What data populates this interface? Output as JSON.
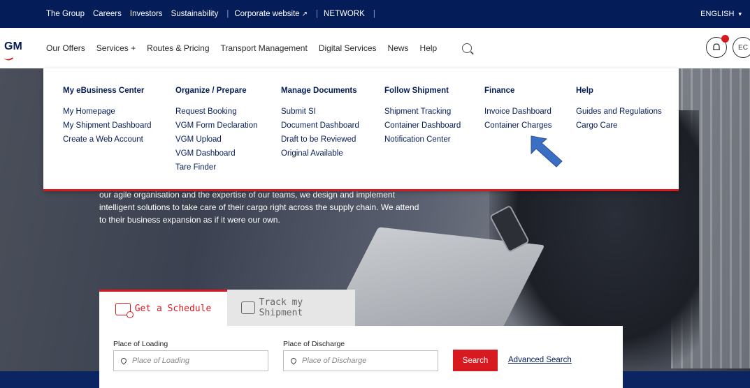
{
  "topbar": {
    "links": [
      "The Group",
      "Careers",
      "Investors",
      "Sustainability"
    ],
    "corporate_website": "Corporate website",
    "network": "NETWORK",
    "language": "ENGLISH"
  },
  "nav": {
    "logo": "GM",
    "items": [
      "Our Offers",
      "Services +",
      "Routes & Pricing",
      "Transport Management",
      "Digital Services",
      "News",
      "Help"
    ],
    "active": "Transport Management",
    "account_initials": "EC"
  },
  "dropdown": {
    "columns": [
      {
        "title": "My eBusiness Center",
        "items": [
          "My Homepage",
          "My Shipment Dashboard",
          "Create a Web Account"
        ]
      },
      {
        "title": "Organize / Prepare",
        "items": [
          "Request Booking",
          "VGM Form Declaration",
          "VGM Upload",
          "VGM Dashboard",
          "Tare Finder"
        ]
      },
      {
        "title": "Manage Documents",
        "items": [
          "Submit SI",
          "Document Dashboard",
          "Draft to be Reviewed",
          "Original Available"
        ]
      },
      {
        "title": "Follow Shipment",
        "items": [
          "Shipment Tracking",
          "Container Dashboard",
          "Notification Center"
        ]
      },
      {
        "title": "Finance",
        "items": [
          "Invoice Dashboard",
          "Container Charges"
        ]
      },
      {
        "title": "Help",
        "items": [
          "Guides and Regulations",
          "Cargo Care"
        ]
      }
    ]
  },
  "hero": {
    "text": "our agile organisation and the expertise of our teams, we design and implement intelligent solutions to take care of their cargo right across the supply chain. We attend to their business expansion as if it were our own."
  },
  "search": {
    "tab_schedule": "Get a Schedule",
    "tab_track": "Track my Shipment",
    "loading_label": "Place of Loading",
    "loading_placeholder": "Place of Loading",
    "discharge_label": "Place of Discharge",
    "discharge_placeholder": "Place of Discharge",
    "search_button": "Search",
    "advanced_link": "Advanced Search"
  },
  "colors": {
    "navy": "#041c58",
    "accent_red": "#d71920",
    "arrow_blue": "#3a6fc4"
  }
}
